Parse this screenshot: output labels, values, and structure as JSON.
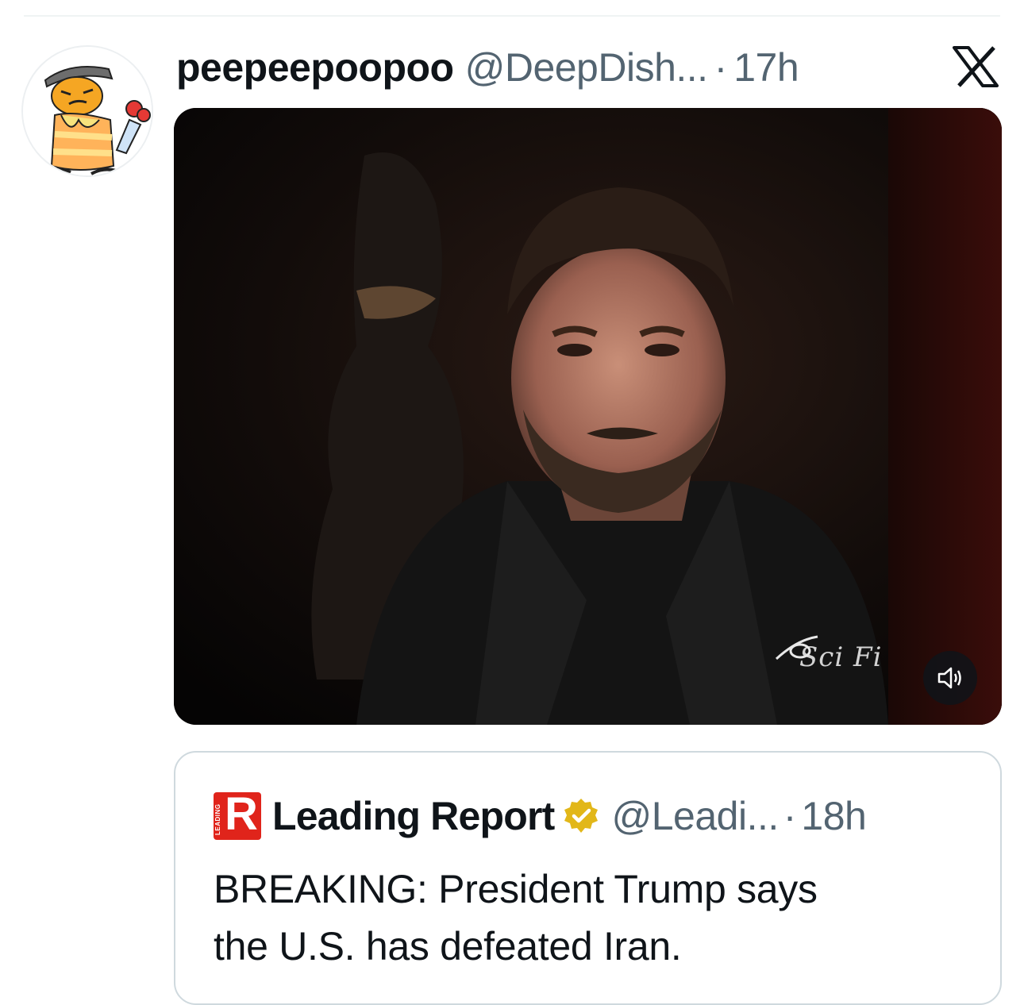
{
  "post": {
    "display_name": "peepeepoopoo",
    "handle": "@DeepDish...",
    "separator": "·",
    "time": "17h",
    "avatar_icon": "cartoon-avatar-icon",
    "platform_icon": "x-logo-icon",
    "media": {
      "type": "video",
      "watermark": "Sci Fi",
      "volume_icon": "speaker-icon"
    }
  },
  "quote": {
    "logo_letter": "R",
    "logo_small_text": "LEADING",
    "display_name": "Leading Report",
    "verified_icon": "verified-badge-icon",
    "verified_color": "#e2b719",
    "handle": "@Leadi...",
    "separator": "·",
    "time": "18h",
    "text_line1": "BREAKING: President Trump says",
    "text_line2": "the U.S. has defeated Iran."
  },
  "colors": {
    "text_primary": "#0f1419",
    "text_secondary": "#536471",
    "border": "#cfd9de",
    "logo_red": "#e0241b"
  }
}
